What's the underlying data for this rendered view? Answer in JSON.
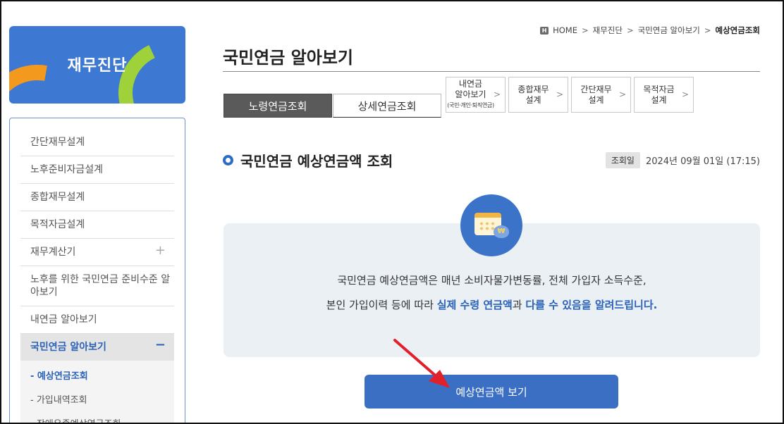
{
  "sidebar": {
    "banner_title": "재무진단",
    "items": [
      {
        "label": "간단재무설계"
      },
      {
        "label": "노후준비자금설계"
      },
      {
        "label": "종합재무설계"
      },
      {
        "label": "목적자금설계"
      },
      {
        "label": "재무계산기",
        "expand": "+"
      },
      {
        "label": "노후를 위한 국민연금 준비수준 알아보기"
      },
      {
        "label": "내연금 알아보기"
      },
      {
        "label": "국민연금 알아보기",
        "collapse": "−"
      }
    ],
    "sub_items": [
      {
        "label": "- 예상연금조회"
      },
      {
        "label": "- 가입내역조회"
      },
      {
        "label": "- 장애유족예상연금조회"
      }
    ]
  },
  "breadcrumb": {
    "home_badge": "H",
    "items": [
      "HOME",
      "재무진단",
      "국민연금 알아보기",
      "예상연금조회"
    ],
    "sep": ">"
  },
  "page": {
    "title": "국민연금 알아보기"
  },
  "tabs": {
    "active": "노령연금조회",
    "normal": "상세연금조회",
    "links": [
      {
        "line1": "내연금",
        "line2": "알아보기",
        "line3": "(국민·개인·퇴직연금)"
      },
      {
        "line1": "종합재무",
        "line2": "설계"
      },
      {
        "line1": "간단재무",
        "line2": "설계"
      },
      {
        "line1": "목적자금",
        "line2": "설계"
      }
    ],
    "chevron": ">"
  },
  "section": {
    "title": "국민연금 예상연금액 조회",
    "query_label": "조회일",
    "query_date": "2024년 09월 01일 (17:15)"
  },
  "info": {
    "icon_coin": "₩",
    "line1": "국민연금 예상연금액은 매년 소비자물가변동률, 전체 가입자 소득수준,",
    "line2_plain_a": "본인 가입이력 등에 따라 ",
    "line2_emph_a": "실제 수령 연금액",
    "line2_plain_b": "과 ",
    "line2_emph_b": "다를 수 있음을 알려드립니다."
  },
  "button": {
    "label": "예상연금액 보기"
  },
  "colors": {
    "primary": "#3a6fc4",
    "accent_text": "#2962b8",
    "annotation_arrow": "#e0202a"
  }
}
